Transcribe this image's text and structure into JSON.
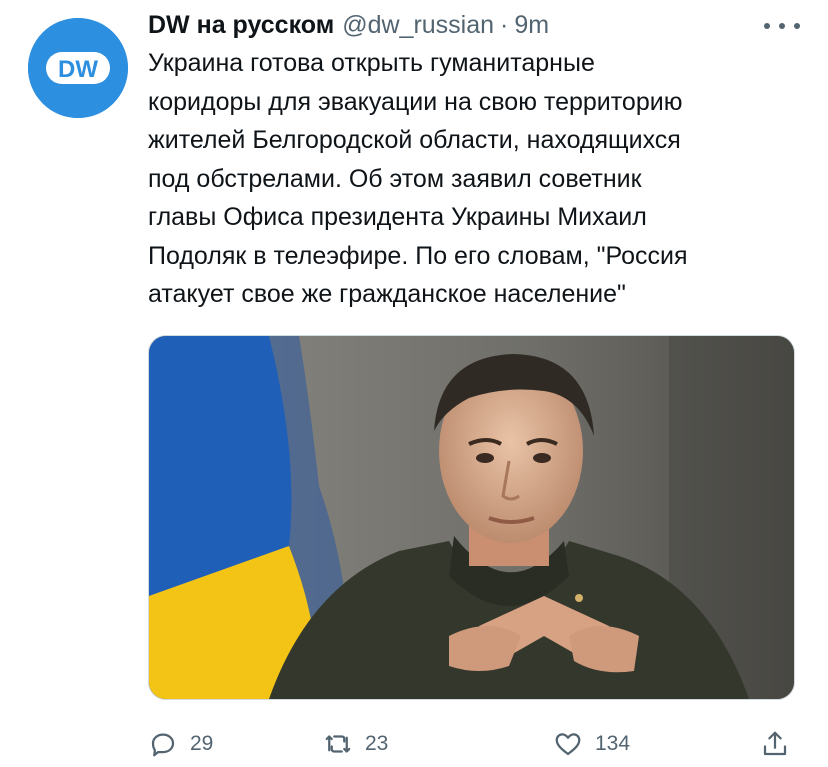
{
  "tweet": {
    "author_name": "DW на русском",
    "author_handle": "@dw_russian",
    "separator": "·",
    "time": "9m",
    "avatar_text": "DW",
    "text_lines": [
      "Украина готова открыть гуманитарные",
      "коридоры для эвакуации на свою территорию",
      "жителей Белгородской области, находящихся",
      "под обстрелами. Об этом заявил советник",
      "главы Офиса президента Украины Михаил",
      "Подоляк в телеэфире. По его словам, \"Россия",
      "атакует свое же гражданское население\""
    ],
    "media": {
      "icons": [
        "ukrainian-flag",
        "man-portrait"
      ]
    },
    "actions": {
      "replies": "29",
      "retweets": "23",
      "likes": "134"
    }
  },
  "colors": {
    "text": "#0f1419",
    "muted": "#536471",
    "avatar_blue": "#2d8fe0",
    "flag_blue": "#1f5fb8",
    "flag_yellow": "#f3c316"
  },
  "icons": [
    "more-icon",
    "reply-icon",
    "retweet-icon",
    "like-icon",
    "share-icon"
  ]
}
